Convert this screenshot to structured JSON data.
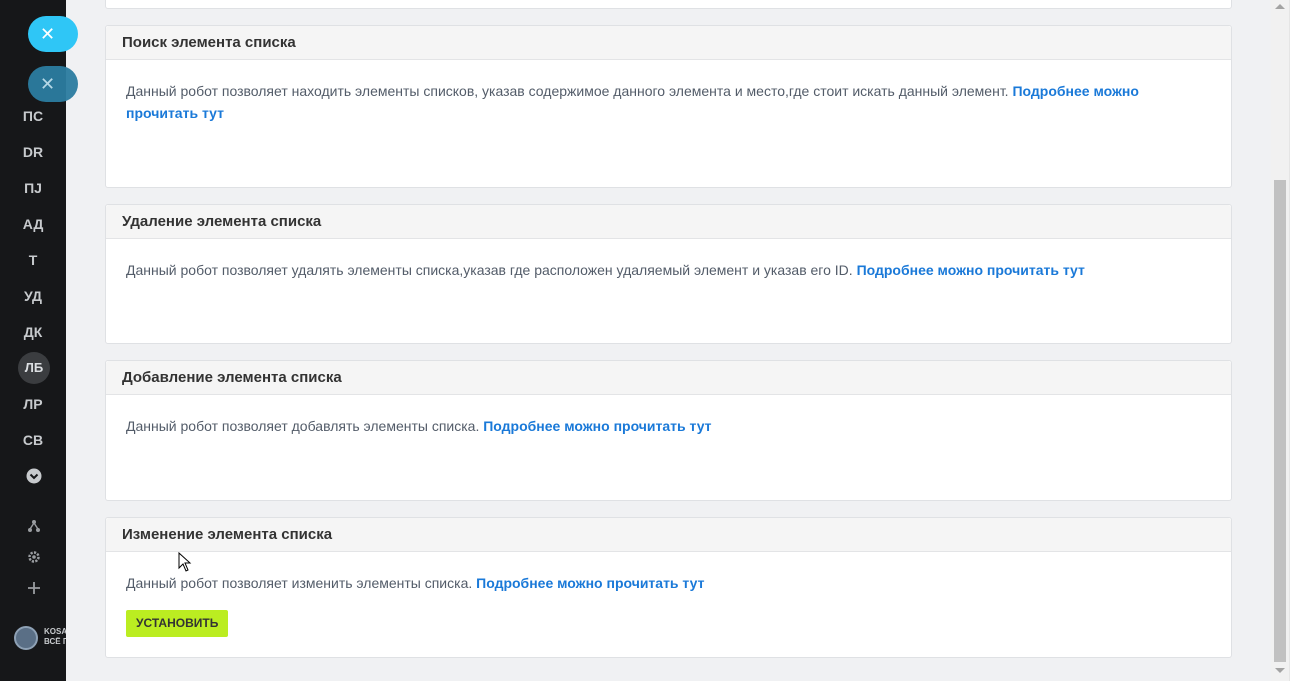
{
  "sidebar": {
    "items": [
      {
        "label": "ПС"
      },
      {
        "label": "DR"
      },
      {
        "label": "ПJ"
      },
      {
        "label": "АД"
      },
      {
        "label": "Т"
      },
      {
        "label": "УД"
      },
      {
        "label": "ДК"
      },
      {
        "label": "ЛБ"
      },
      {
        "label": "ЛР"
      },
      {
        "label": "СВ"
      }
    ],
    "logo_text_line1": "KOSA",
    "logo_text_line2": "ВСЁ П"
  },
  "close_icon": "✕",
  "cards": [
    {
      "title": "Поиск элемента списка",
      "text": "Данный робот позволяет находить элементы списков, указав содержимое данного элемента и место,где стоит искать данный элемент.",
      "link": "Подробнее можно прочитать тут"
    },
    {
      "title": "Удаление элемента списка",
      "text": "Данный робот позволяет удалять элементы списка,указав где расположен удаляемый элемент и указав его ID.",
      "link": "Подробнее можно прочитать тут"
    },
    {
      "title": "Добавление элемента списка",
      "text": "Данный робот позволяет добавлять элементы списка.",
      "link": "Подробнее можно прочитать тут"
    },
    {
      "title": "Изменение элемента списка",
      "text": "Данный робот позволяет изменить элементы списка.",
      "link": "Подробнее можно прочитать тут",
      "button": "УСТАНОВИТЬ"
    }
  ],
  "colors": {
    "accent_link": "#1a79d8",
    "install_button": "#bbed21",
    "close_button": "#2fc6f6",
    "sidebar_bg": "#161719"
  }
}
